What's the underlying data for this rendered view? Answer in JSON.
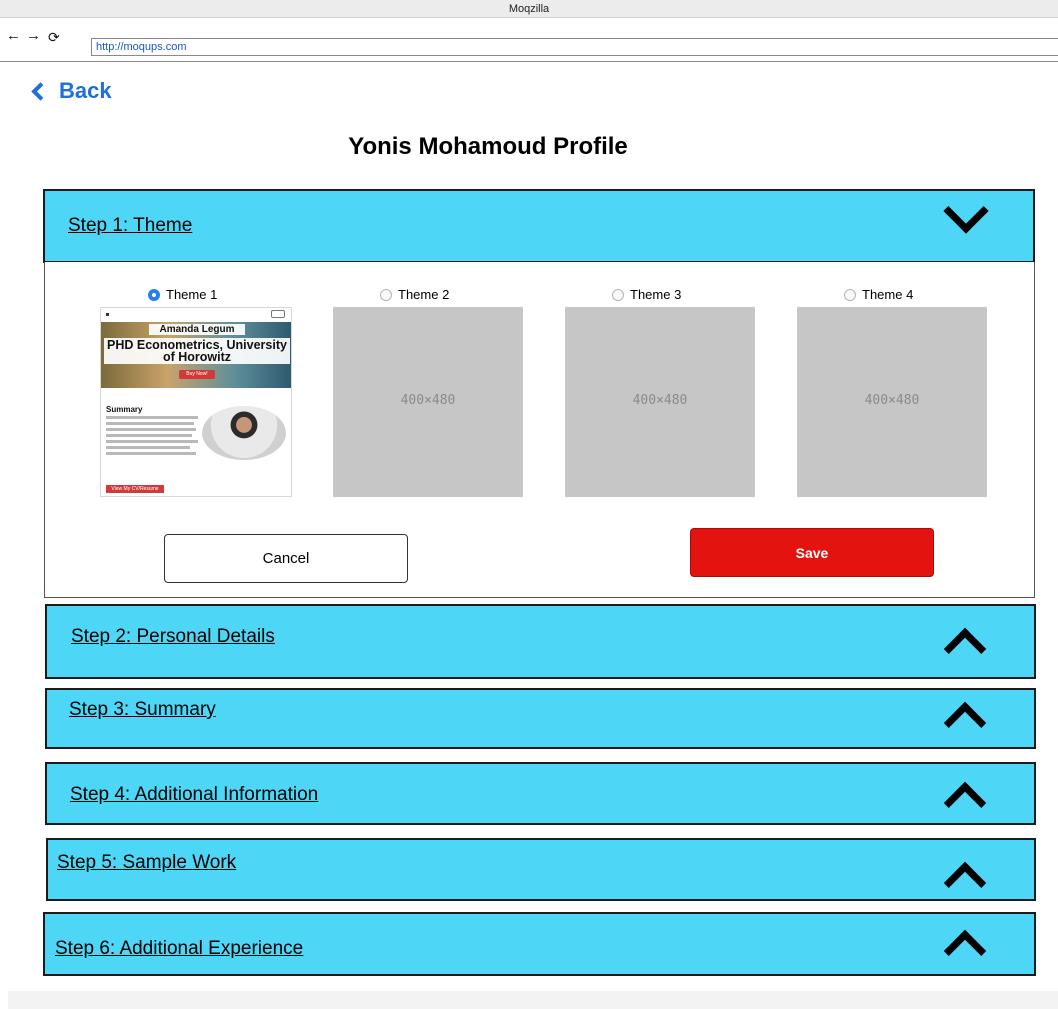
{
  "browser": {
    "window_title": "Moqzilla",
    "back_icon": "←",
    "forward_icon": "→",
    "reload_icon": "⟳",
    "url": "http://moqups.com"
  },
  "page": {
    "back_label": "Back",
    "title": "Yonis Mohamoud Profile"
  },
  "steps": [
    {
      "label": "Step 1: Theme",
      "expanded": true
    },
    {
      "label": "Step 2: Personal Details",
      "expanded": false
    },
    {
      "label": "Step 3: Summary",
      "expanded": false
    },
    {
      "label": "Step 4: Additional Information",
      "expanded": false
    },
    {
      "label": "Step 5: Sample Work",
      "expanded": false
    },
    {
      "label": "Step 6: Additional Experience",
      "expanded": false
    }
  ],
  "themes": [
    {
      "label": "Theme 1",
      "selected": true
    },
    {
      "label": "Theme 2",
      "selected": false,
      "placeholder": "400×480"
    },
    {
      "label": "Theme 3",
      "selected": false,
      "placeholder": "400×480"
    },
    {
      "label": "Theme 4",
      "selected": false,
      "placeholder": "400×480"
    }
  ],
  "theme1_preview": {
    "name": "Amanda Legum",
    "degree": "PHD Econometrics, University of Horowitz",
    "buy_button": "Buy Now!",
    "summary_heading": "Summary",
    "view_button": "View My CV/Resume"
  },
  "actions": {
    "cancel_label": "Cancel",
    "save_label": "Save"
  },
  "colors": {
    "accordion_header": "#4dd6f5",
    "save_button": "#e3140f",
    "link": "#1e6fdc"
  }
}
